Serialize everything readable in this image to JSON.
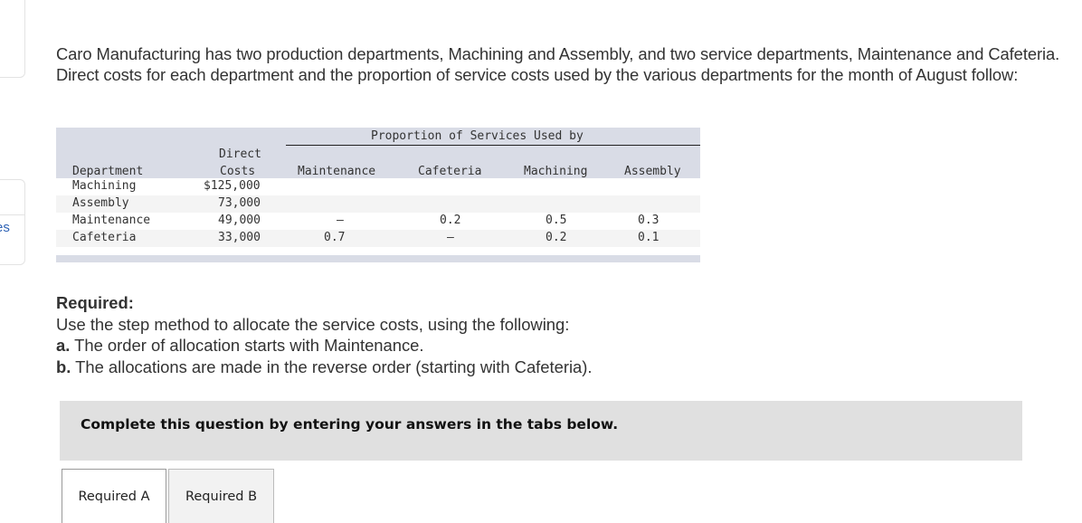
{
  "sidebar": {
    "partial_link_text": "es"
  },
  "intro_text": "Caro Manufacturing has two production departments, Machining and Assembly, and two service departments, Maintenance and Cafeteria. Direct costs for each department and the proportion of service costs used by the various departments for the month of August follow:",
  "table": {
    "group_header": "Proportion of Services Used by",
    "headers": {
      "department": "Department",
      "direct_costs_line1": "Direct",
      "direct_costs_line2": "Costs",
      "maintenance": "Maintenance",
      "cafeteria": "Cafeteria",
      "machining": "Machining",
      "assembly": "Assembly"
    },
    "rows": [
      {
        "department": "Machining",
        "direct_costs": "$125,000",
        "maintenance": "",
        "cafeteria": "",
        "machining": "",
        "assembly": ""
      },
      {
        "department": "Assembly",
        "direct_costs": "73,000",
        "maintenance": "",
        "cafeteria": "",
        "machining": "",
        "assembly": ""
      },
      {
        "department": "Maintenance",
        "direct_costs": "49,000",
        "maintenance": "—",
        "cafeteria": "0.2",
        "machining": "0.5",
        "assembly": "0.3"
      },
      {
        "department": "Cafeteria",
        "direct_costs": "33,000",
        "maintenance": "0.7",
        "cafeteria": "—",
        "machining": "0.2",
        "assembly": "0.1"
      }
    ]
  },
  "required": {
    "heading": "Required:",
    "instruction": "Use the step method to allocate the service costs, using the following:",
    "items": [
      {
        "marker": "a.",
        "text": " The order of allocation starts with Maintenance."
      },
      {
        "marker": "b.",
        "text": " The allocations are made in the reverse order (starting with Cafeteria)."
      }
    ]
  },
  "banner_text": "Complete this question by entering your answers in the tabs below.",
  "tabs": [
    {
      "label": "Required A",
      "active": true
    },
    {
      "label": "Required B",
      "active": false
    }
  ]
}
